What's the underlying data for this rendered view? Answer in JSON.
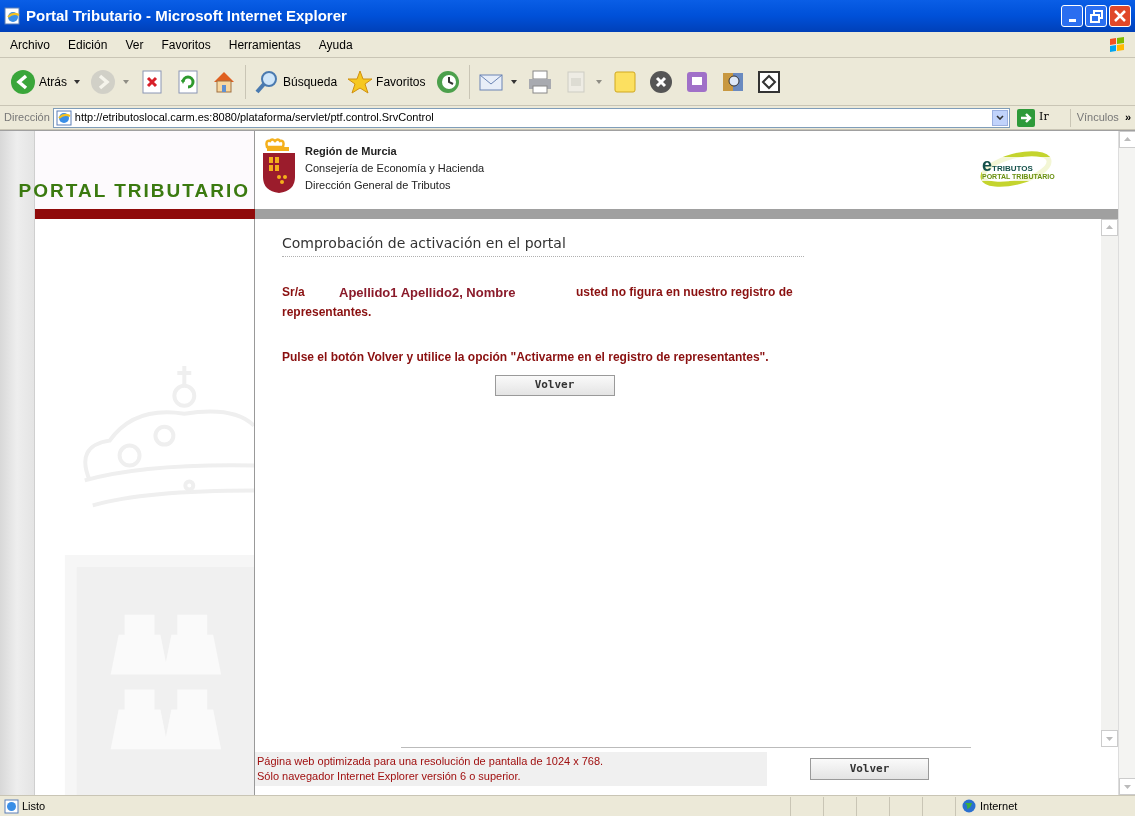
{
  "window": {
    "title": "Portal Tributario - Microsoft Internet Explorer",
    "controls": [
      {
        "kind": "minimize"
      },
      {
        "kind": "restore"
      },
      {
        "kind": "close"
      }
    ]
  },
  "menu_bar": [
    "Archivo",
    "Edición",
    "Ver",
    "Favoritos",
    "Herramientas",
    "Ayuda"
  ],
  "toolbar": [
    {
      "kind": "back",
      "label": "Atrás",
      "dropdown": true,
      "disabled": false
    },
    {
      "kind": "forward",
      "dropdown": true,
      "disabled": true
    },
    {
      "kind": "stop",
      "dropdown": false,
      "disabled": false
    },
    {
      "kind": "refresh",
      "dropdown": false,
      "disabled": false
    },
    {
      "kind": "home",
      "dropdown": false,
      "disabled": false
    },
    {
      "kind": "search",
      "label": "Búsqueda",
      "dropdown": false,
      "disabled": false
    },
    {
      "kind": "favorites",
      "label": "Favoritos",
      "dropdown": false,
      "disabled": false
    },
    {
      "kind": "history",
      "dropdown": false,
      "disabled": false
    },
    {
      "kind": "mail",
      "dropdown": true,
      "disabled": false
    },
    {
      "kind": "print",
      "dropdown": false,
      "disabled": false
    },
    {
      "kind": "edit",
      "dropdown": true,
      "disabled": true
    },
    {
      "kind": "note",
      "dropdown": false,
      "disabled": false
    },
    {
      "kind": "block",
      "dropdown": false,
      "disabled": false
    },
    {
      "kind": "messenger",
      "dropdown": false,
      "disabled": false
    },
    {
      "kind": "research",
      "dropdown": false,
      "disabled": false
    },
    {
      "kind": "frame",
      "dropdown": false,
      "disabled": false
    }
  ],
  "address_bar": {
    "label": "Dirección",
    "value": "http://etributoslocal.carm.es:8080/plataforma/servlet/ptf.control.SrvControl",
    "go": "Ir",
    "links": "Vínculos",
    "more": "»"
  },
  "header": {
    "portal_title": "PORTAL TRIBUTARIO",
    "org_name": "Región de Murcia",
    "org_lines": [
      "Consejería de Economía y Hacienda",
      "Dirección General de Tributos"
    ],
    "logo": {
      "mark": "e",
      "name": "TRIBUTOS",
      "tagline": "PORTAL TRIBUTARIO"
    }
  },
  "content": {
    "heading": "Comprobación de activación en el portal",
    "salutation": "Sr/a",
    "person": "Apellido1 Apellido2, Nombre",
    "message": "usted no figura en nuestro registro de",
    "message_cont": "representantes.",
    "instruction": "Pulse el botón Volver y utilice la opción \"Activarme en el registro de representantes\".",
    "button": "Volver"
  },
  "footer": {
    "notes": [
      "Página web optimizada para una resolución de pantalla de 1024 x 768.",
      "Sólo navegador Internet Explorer versión 6 o superior."
    ],
    "button": "Volver"
  },
  "status_bar": {
    "status": "Listo",
    "zone": "Internet"
  }
}
